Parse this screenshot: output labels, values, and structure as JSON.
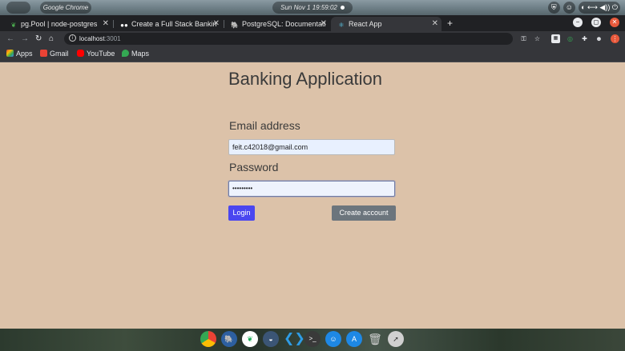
{
  "os": {
    "apple_glyph": "",
    "app_name": "Google Chrome",
    "clock": "Sun Nov 1  19:59:02"
  },
  "tabs": [
    {
      "label": "pg.Pool | node-postgres",
      "favicon": "leaf-icon",
      "favicon_color": "#4caf50"
    },
    {
      "label": "Create a Full Stack Bankin",
      "favicon": "medium-icon",
      "favicon_color": "#ffffff"
    },
    {
      "label": "PostgreSQL: Documentati",
      "favicon": "elephant-icon",
      "favicon_color": "#336791"
    },
    {
      "label": "React App",
      "favicon": "react-icon",
      "favicon_color": "#61dafb"
    }
  ],
  "address_bar": {
    "host": "localhost",
    "port": ":3001"
  },
  "bookmarks": [
    {
      "label": "Apps",
      "icon": "apps-grid-icon",
      "color": "#ea4335"
    },
    {
      "label": "Gmail",
      "icon": "gmail-icon",
      "color": "#ea4335"
    },
    {
      "label": "YouTube",
      "icon": "youtube-icon",
      "color": "#ff0000"
    },
    {
      "label": "Maps",
      "icon": "maps-icon",
      "color": "#34a853"
    }
  ],
  "page": {
    "title": "Banking Application",
    "email_label": "Email address",
    "email_value": "feit.c42018@gmail.com",
    "password_label": "Password",
    "password_value": "•••••••••",
    "login_label": "Login",
    "create_label": "Create account"
  },
  "colors": {
    "page_background": "#dcc2a9",
    "login_button": "#4a46f0",
    "create_button": "#6c757d"
  }
}
